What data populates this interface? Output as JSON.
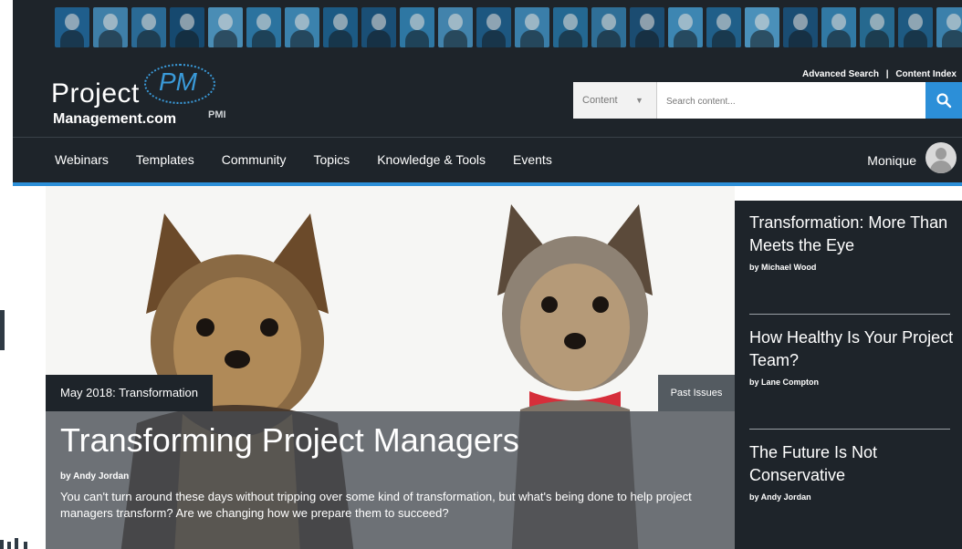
{
  "header": {
    "logo": {
      "line1": "Project",
      "rpm": "PM",
      "line2": "Management.com",
      "pmi": "PMI"
    },
    "top_links": {
      "advanced_search": "Advanced Search",
      "separator": "|",
      "content_index": "Content Index"
    },
    "search": {
      "scope": "Content",
      "placeholder": "Search content..."
    },
    "nav": [
      {
        "label": "Webinars"
      },
      {
        "label": "Templates"
      },
      {
        "label": "Community"
      },
      {
        "label": "Topics"
      },
      {
        "label": "Knowledge & Tools"
      },
      {
        "label": "Events"
      }
    ],
    "user": {
      "name": "Monique"
    },
    "accent": "#2c8fd8"
  },
  "hero": {
    "issue_label": "May 2018: Transformation",
    "past_issues": "Past Issues",
    "title": "Transforming Project Managers",
    "author": "by Andy Jordan",
    "excerpt": "You can't turn around these days without tripping over some kind of transformation, but what's being done to help project managers transform? Are we changing how we prepare them to succeed?"
  },
  "sidebar": {
    "articles": [
      {
        "title": "Transformation: More Than Meets the Eye",
        "author": "by Michael Wood"
      },
      {
        "title": "How Healthy Is Your Project Team?",
        "author": "by Lane Compton"
      },
      {
        "title": "The Future Is Not Conservative",
        "author": "by Andy Jordan"
      }
    ]
  }
}
